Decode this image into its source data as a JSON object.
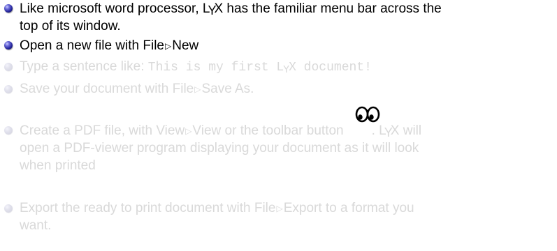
{
  "items": [
    {
      "line1_a": "Like microsoft word processor, L",
      "line1_y": "Y",
      "line1_b": "X has the familiar menu bar across the",
      "line2": "top of its window."
    },
    {
      "pre": "Open a new file with File",
      "tri": "▷",
      "post": "New"
    },
    {
      "pre": "Type a sentence like: ",
      "code_a": "This is my first L",
      "code_y": "Y",
      "code_b": "X document!"
    },
    {
      "pre": "Save your document with File",
      "tri": "▷",
      "post": "Save As."
    },
    {
      "l1_pre": "Create a PDF file, with View",
      "tri": "▷",
      "l1_mid": "View or the toolbar button",
      "l1_post_a": ". L",
      "l1_y": "Y",
      "l1_post_b": "X will",
      "line2": "open a PDF-viewer program displaying your document as it will look",
      "line3": "when printed",
      "icon": "eyes-icon"
    },
    {
      "pre": "Export the ready to print document with File",
      "tri": "▷",
      "post": "Export to a format you",
      "line2": "want."
    }
  ],
  "colors": {
    "text_active": "#000000",
    "text_faded": "#d9d9d9",
    "bullet_active": "#24249a",
    "bullet_faded": "#d2d2de"
  }
}
